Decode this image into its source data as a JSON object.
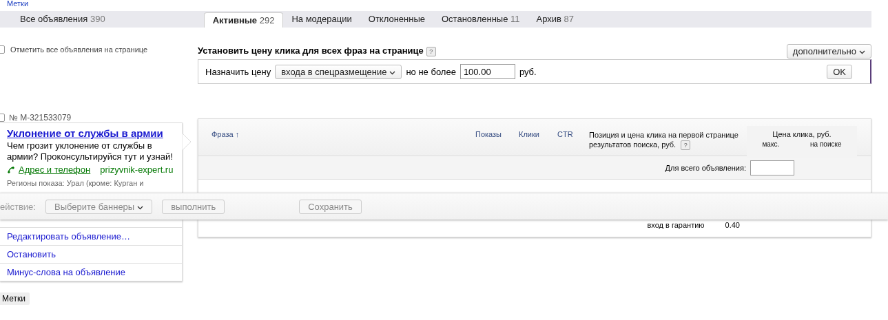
{
  "top_link": "Метки",
  "tabs": [
    {
      "label": "Все объявления",
      "count": "390",
      "selected": false
    },
    {
      "label": "Активные",
      "count": "292",
      "selected": true
    },
    {
      "label": "На модерации",
      "selected": false
    },
    {
      "label": "Отклоненные",
      "selected": false
    },
    {
      "label": "Остановленные",
      "count": "11",
      "selected": false
    },
    {
      "label": "Архив",
      "count": "87",
      "selected": false
    }
  ],
  "select_all": {
    "label": "Отметить все объявления на странице",
    "checked": false
  },
  "price_panel": {
    "title": "Установить цену клика для всех фраз на странице",
    "help": "?",
    "more_button": "дополнительно",
    "prefix": "Назначить цену",
    "mode": "входа в спецразмещение",
    "middle": "но не более",
    "value": "100.00",
    "unit": "руб.",
    "ok": "OK"
  },
  "ad": {
    "number": "№ M-321533079",
    "checked": false,
    "title": "Уклонение от службы в армии",
    "text": "Чем грозит уклонение от службы в армии? Проконсультируйся тут и узнай!",
    "contact": "Адрес и телефон",
    "domain": "prizyvnik-expert.ru",
    "regions": "Регионы показа: Урал (кроме: Курган и",
    "actions": [
      "Редактировать объявление…",
      "Остановить",
      "Минус-слова на объявление"
    ]
  },
  "tags_button": "Метки",
  "table": {
    "columns": [
      {
        "label": "Фраза",
        "sort": "↑"
      },
      {
        "label": "Показы"
      },
      {
        "label": "Клики"
      },
      {
        "label": "CTR"
      },
      {
        "label": "Позиция и цена клика на первой странице результатов поиска, руб.",
        "help": "?"
      }
    ],
    "price_group": {
      "label": "Цена клика, руб.",
      "sub": [
        "макс.",
        "на поиске"
      ]
    },
    "whole_ad_label": "Для всего объявления:",
    "rows": [
      {
        "position": "вход в гарантию",
        "price": "0.40"
      }
    ]
  },
  "action_bar": {
    "label": "ействие:",
    "select": "Выберите баннеры",
    "run": "выполнить",
    "save": "Сохранить"
  }
}
